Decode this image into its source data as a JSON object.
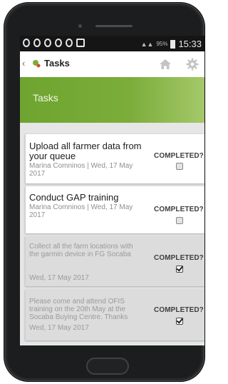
{
  "status_bar": {
    "signal": "95%",
    "time": "15:33"
  },
  "app_bar": {
    "back_glyph": "‹",
    "title": "Tasks",
    "home_icon": "home-icon",
    "settings_icon": "gear-icon"
  },
  "header": {
    "title": "Tasks"
  },
  "tasks": [
    {
      "title": "Upload all farmer data from your queue",
      "meta": "Marina Comninos | Wed, 17 May 2017",
      "completed_label": "COMPLETED?",
      "completed": false
    },
    {
      "title": "Conduct GAP training",
      "meta": "Marina Comninos | Wed, 17 May 2017",
      "completed_label": "COMPLETED?",
      "completed": false
    },
    {
      "message": "Collect all the farm locations with the garmin device in FG Socaba",
      "date": "Wed, 17 May 2017",
      "completed_label": "COMPLETED?",
      "completed": true
    },
    {
      "message": "Please come and attend OFIS training on the 20th May at the Socaba Buying Centre. Thanks",
      "date": "Wed, 17 May 2017",
      "completed_label": "COMPLETED?",
      "completed": true
    }
  ],
  "colors": {
    "header_green": "#7cad3a",
    "status_bar": "#151515",
    "completed_card_bg": "#dcdcdc"
  }
}
